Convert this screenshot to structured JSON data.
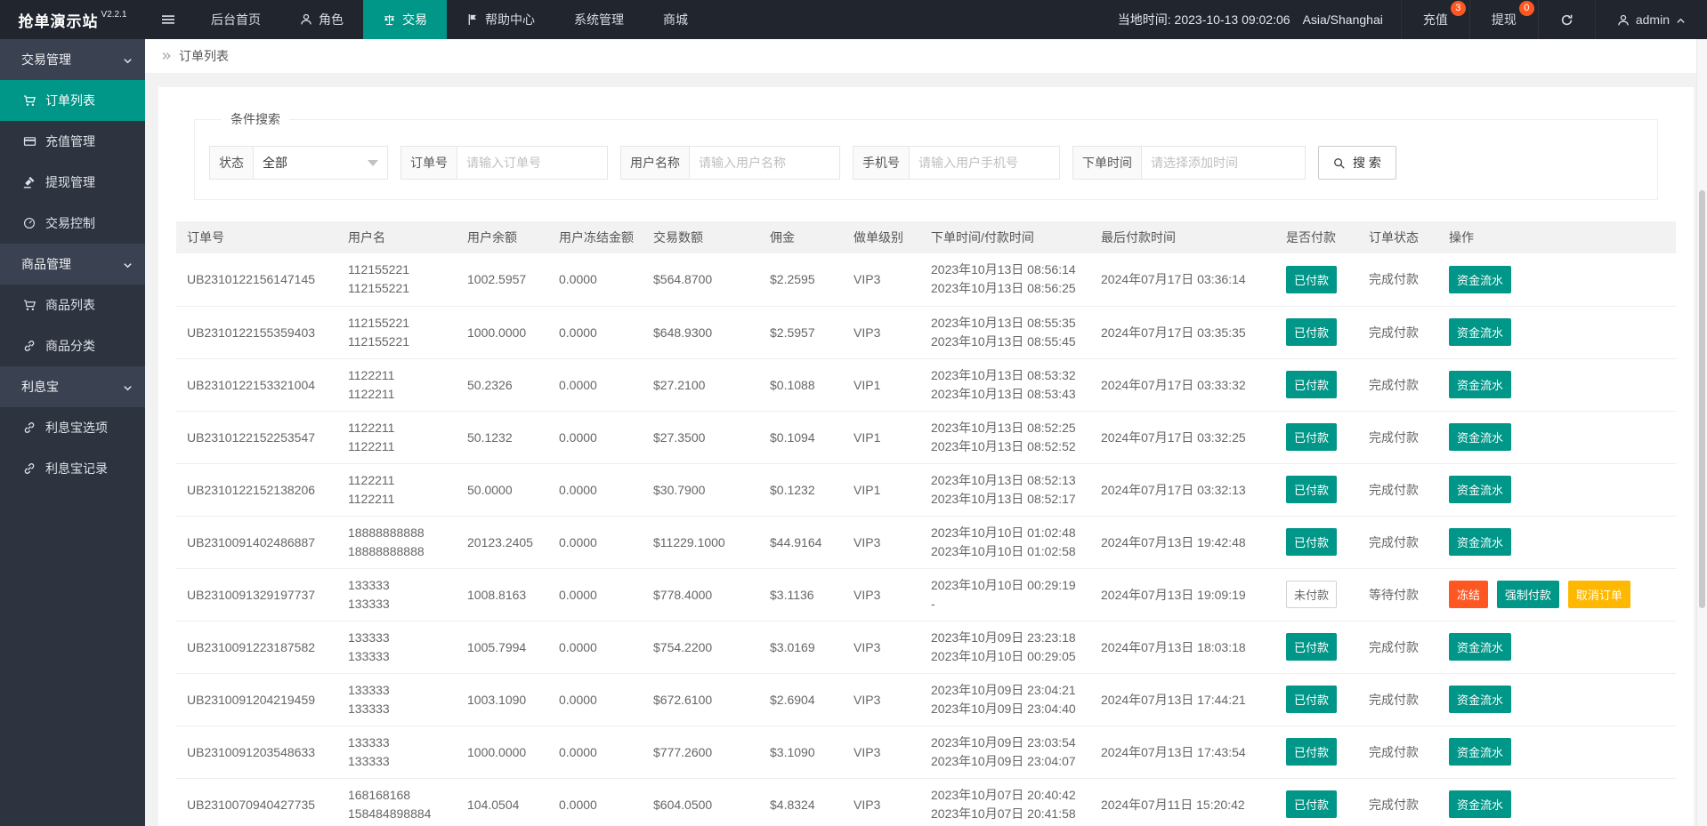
{
  "app": {
    "title": "抢单演示站",
    "version": "V2.2.1"
  },
  "colors": {
    "accent_teal": "#009688",
    "danger_red": "#FF5722",
    "warning_yellow": "#FFB800"
  },
  "topnav": {
    "menu": [
      {
        "label": "后台首页",
        "icon": "",
        "state": ""
      },
      {
        "label": "角色",
        "icon": "user",
        "state": ""
      },
      {
        "label": "交易",
        "icon": "scales",
        "state": "active"
      },
      {
        "label": "帮助中心",
        "icon": "flag",
        "state": ""
      },
      {
        "label": "系统管理",
        "icon": "",
        "state": ""
      },
      {
        "label": "商城",
        "icon": "",
        "state": ""
      }
    ],
    "local_time": "当地时间: 2023-10-13 09:02:06",
    "timezone": "Asia/Shanghai",
    "shortcuts": [
      {
        "label": "充值",
        "badge": "3"
      },
      {
        "label": "提现",
        "badge": "0"
      }
    ],
    "refresh_icon": "refresh",
    "username": "admin"
  },
  "sidebar": {
    "groups": [
      {
        "label": "交易管理",
        "state": "expanded",
        "items": [
          {
            "label": "订单列表",
            "icon": "cart",
            "state": "active"
          },
          {
            "label": "充值管理",
            "icon": "card",
            "state": ""
          },
          {
            "label": "提现管理",
            "icon": "gavel",
            "state": ""
          },
          {
            "label": "交易控制",
            "icon": "gauge",
            "state": ""
          }
        ]
      },
      {
        "label": "商品管理",
        "state": "expanded",
        "items": [
          {
            "label": "商品列表",
            "icon": "cart",
            "state": ""
          },
          {
            "label": "商品分类",
            "icon": "link",
            "state": ""
          }
        ]
      },
      {
        "label": "利息宝",
        "state": "expanded",
        "items": [
          {
            "label": "利息宝选项",
            "icon": "link",
            "state": ""
          },
          {
            "label": "利息宝记录",
            "icon": "link",
            "state": ""
          }
        ]
      }
    ]
  },
  "breadcrumb": {
    "current": "订单列表"
  },
  "search": {
    "legend": "条件搜索",
    "status_label": "状态",
    "status_value": "全部",
    "order_label": "订单号",
    "order_placeholder": "请输入订单号",
    "username_label": "用户名称",
    "username_placeholder": "请输入用户名称",
    "phone_label": "手机号",
    "phone_placeholder": "请输入用户手机号",
    "time_label": "下单时间",
    "time_placeholder": "请选择添加时间",
    "button_label": "搜 索"
  },
  "table": {
    "headers": [
      "订单号",
      "用户名",
      "用户余额",
      "用户冻结金额",
      "交易数额",
      "佣金",
      "做单级别",
      "下单时间/付款时间",
      "最后付款时间",
      "是否付款",
      "订单状态",
      "操作"
    ],
    "rows": [
      {
        "order_no": "UB2310122156147145",
        "user1": "112155221",
        "user2": "112155221",
        "balance": "1002.5957",
        "frozen": "0.0000",
        "amount": "$564.8700",
        "commission": "$2.2595",
        "level": "VIP3",
        "time1": "2023年10月13日 08:56:14",
        "time2": "2023年10月13日 08:56:25",
        "last_time": "2024年07月17日 03:36:14",
        "paid_state": "paid",
        "paid_label": "已付款",
        "status": "完成付款",
        "actions": [
          {
            "label": "资金流水",
            "color": "teal"
          }
        ]
      },
      {
        "order_no": "UB2310122155359403",
        "user1": "112155221",
        "user2": "112155221",
        "balance": "1000.0000",
        "frozen": "0.0000",
        "amount": "$648.9300",
        "commission": "$2.5957",
        "level": "VIP3",
        "time1": "2023年10月13日 08:55:35",
        "time2": "2023年10月13日 08:55:45",
        "last_time": "2024年07月17日 03:35:35",
        "paid_state": "paid",
        "paid_label": "已付款",
        "status": "完成付款",
        "actions": [
          {
            "label": "资金流水",
            "color": "teal"
          }
        ]
      },
      {
        "order_no": "UB2310122153321004",
        "user1": "1122211",
        "user2": "1122211",
        "balance": "50.2326",
        "frozen": "0.0000",
        "amount": "$27.2100",
        "commission": "$0.1088",
        "level": "VIP1",
        "time1": "2023年10月13日 08:53:32",
        "time2": "2023年10月13日 08:53:43",
        "last_time": "2024年07月17日 03:33:32",
        "paid_state": "paid",
        "paid_label": "已付款",
        "status": "完成付款",
        "actions": [
          {
            "label": "资金流水",
            "color": "teal"
          }
        ]
      },
      {
        "order_no": "UB2310122152253547",
        "user1": "1122211",
        "user2": "1122211",
        "balance": "50.1232",
        "frozen": "0.0000",
        "amount": "$27.3500",
        "commission": "$0.1094",
        "level": "VIP1",
        "time1": "2023年10月13日 08:52:25",
        "time2": "2023年10月13日 08:52:52",
        "last_time": "2024年07月17日 03:32:25",
        "paid_state": "paid",
        "paid_label": "已付款",
        "status": "完成付款",
        "actions": [
          {
            "label": "资金流水",
            "color": "teal"
          }
        ]
      },
      {
        "order_no": "UB2310122152138206",
        "user1": "1122211",
        "user2": "1122211",
        "balance": "50.0000",
        "frozen": "0.0000",
        "amount": "$30.7900",
        "commission": "$0.1232",
        "level": "VIP1",
        "time1": "2023年10月13日 08:52:13",
        "time2": "2023年10月13日 08:52:17",
        "last_time": "2024年07月17日 03:32:13",
        "paid_state": "paid",
        "paid_label": "已付款",
        "status": "完成付款",
        "actions": [
          {
            "label": "资金流水",
            "color": "teal"
          }
        ]
      },
      {
        "order_no": "UB2310091402486887",
        "user1": "18888888888",
        "user2": "18888888888",
        "balance": "20123.2405",
        "frozen": "0.0000",
        "amount": "$11229.1000",
        "commission": "$44.9164",
        "level": "VIP3",
        "time1": "2023年10月10日 01:02:48",
        "time2": "2023年10月10日 01:02:58",
        "last_time": "2024年07月13日 19:42:48",
        "paid_state": "paid",
        "paid_label": "已付款",
        "status": "完成付款",
        "actions": [
          {
            "label": "资金流水",
            "color": "teal"
          }
        ]
      },
      {
        "order_no": "UB2310091329197737",
        "user1": "133333",
        "user2": "133333",
        "balance": "1008.8163",
        "frozen": "0.0000",
        "amount": "$778.4000",
        "commission": "$3.1136",
        "level": "VIP3",
        "time1": "2023年10月10日 00:29:19",
        "time2": "-",
        "last_time": "2024年07月13日 19:09:19",
        "paid_state": "unpaid",
        "paid_label": "未付款",
        "status": "等待付款",
        "actions": [
          {
            "label": "冻结",
            "color": "red"
          },
          {
            "label": "强制付款",
            "color": "teal"
          },
          {
            "label": "取消订单",
            "color": "yellow"
          }
        ]
      },
      {
        "order_no": "UB2310091223187582",
        "user1": "133333",
        "user2": "133333",
        "balance": "1005.7994",
        "frozen": "0.0000",
        "amount": "$754.2200",
        "commission": "$3.0169",
        "level": "VIP3",
        "time1": "2023年10月09日 23:23:18",
        "time2": "2023年10月10日 00:29:05",
        "last_time": "2024年07月13日 18:03:18",
        "paid_state": "paid",
        "paid_label": "已付款",
        "status": "完成付款",
        "actions": [
          {
            "label": "资金流水",
            "color": "teal"
          }
        ]
      },
      {
        "order_no": "UB2310091204219459",
        "user1": "133333",
        "user2": "133333",
        "balance": "1003.1090",
        "frozen": "0.0000",
        "amount": "$672.6100",
        "commission": "$2.6904",
        "level": "VIP3",
        "time1": "2023年10月09日 23:04:21",
        "time2": "2023年10月09日 23:04:40",
        "last_time": "2024年07月13日 17:44:21",
        "paid_state": "paid",
        "paid_label": "已付款",
        "status": "完成付款",
        "actions": [
          {
            "label": "资金流水",
            "color": "teal"
          }
        ]
      },
      {
        "order_no": "UB2310091203548633",
        "user1": "133333",
        "user2": "133333",
        "balance": "1000.0000",
        "frozen": "0.0000",
        "amount": "$777.2600",
        "commission": "$3.1090",
        "level": "VIP3",
        "time1": "2023年10月09日 23:03:54",
        "time2": "2023年10月09日 23:04:07",
        "last_time": "2024年07月13日 17:43:54",
        "paid_state": "paid",
        "paid_label": "已付款",
        "status": "完成付款",
        "actions": [
          {
            "label": "资金流水",
            "color": "teal"
          }
        ]
      },
      {
        "order_no": "UB2310070940427735",
        "user1": "168168168",
        "user2": "158484898884",
        "balance": "104.0504",
        "frozen": "0.0000",
        "amount": "$604.0500",
        "commission": "$4.8324",
        "level": "VIP3",
        "time1": "2023年10月07日 20:40:42",
        "time2": "2023年10月07日 20:41:58",
        "last_time": "2024年07月11日 15:20:42",
        "paid_state": "paid",
        "paid_label": "已付款",
        "status": "完成付款",
        "actions": [
          {
            "label": "资金流水",
            "color": "teal"
          }
        ]
      }
    ]
  }
}
